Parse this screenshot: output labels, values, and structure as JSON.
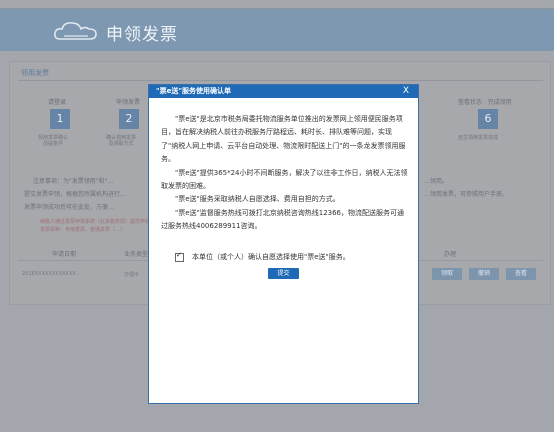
{
  "header": {
    "title": "申领发票"
  },
  "section": {
    "title": "领用发票"
  },
  "steps": [
    {
      "label": "请登录",
      "num": "1",
      "sub": "领用发票确认\n前提条件"
    },
    {
      "label": "申领发票",
      "num": "2",
      "sub": "确认领用发票\n及领取方式"
    },
    {
      "label": "查看状态 · 完成领用",
      "num": "6",
      "sub": "自主领用发票完成"
    }
  ],
  "notices": {
    "line1": "注意事项：为\"发票领用\"和\"…",
    "line2": "提交发票申领，根据您所属机构进行…",
    "line3": "发票申领成功后可在此处，方便…",
    "right1": "…领用。",
    "right2": "…领用发票，可参照用户手册。",
    "red1": "纳税人通过发票申领系统（北京税务局）提交申领……",
    "red2": "发票票种：专用发票、普通发票（…）"
  },
  "table": {
    "headers": [
      "申请日期",
      "业务类型",
      "办理"
    ],
    "cells": [
      "2018XXXXXXXXXXXX",
      "",
      "办理中"
    ],
    "buttons": [
      "领取",
      "撤销",
      "查看"
    ]
  },
  "modal": {
    "title": "\"票e送\"服务使用确认单",
    "close": "X",
    "paragraphs": [
      "\"票e送\"是北京市税务局委托物流服务单位推出的发票网上领用便民服务项目，旨在解决纳税人前往办税服务厅路程远、耗时长、排队难等问题，实现了\"纳税人网上申请、云平台自动处理、物流限时配送上门\"的一条龙发票领用服务。",
      "\"票e送\"提供365*24小时不间断服务，解决了以往非工作日，纳税人无法领取发票的困难。",
      "\"票e送\"服务采取纳税人自愿选择、费用自担的方式。",
      "\"票e送\"监督服务热线可拨打北京纳税咨询热线12366，物流配送服务可通过服务热线4006289911咨询。"
    ],
    "consent": "本单位（或个人）确认自愿选择使用\"票e送\"服务。",
    "submit": "提交"
  }
}
